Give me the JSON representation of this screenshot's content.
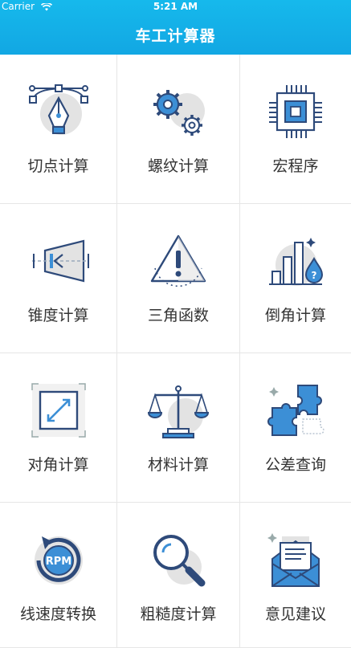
{
  "status_bar": {
    "carrier": "Carrier",
    "time": "5:21 AM"
  },
  "header": {
    "title": "车工计算器"
  },
  "colors": {
    "header": "#12a7e3",
    "icon_stroke": "#2e4a7a",
    "icon_accent": "#3c8fd6",
    "icon_shadow": "#e3e3e3"
  },
  "grid": {
    "items": [
      {
        "label": "切点计算",
        "icon": "pen-tool-icon"
      },
      {
        "label": "螺纹计算",
        "icon": "gears-icon"
      },
      {
        "label": "宏程序",
        "icon": "chip-icon"
      },
      {
        "label": "锥度计算",
        "icon": "taper-icon"
      },
      {
        "label": "三角函数",
        "icon": "warning-triangle-icon"
      },
      {
        "label": "倒角计算",
        "icon": "bar-chart-icon"
      },
      {
        "label": "对角计算",
        "icon": "diagonal-arrow-icon"
      },
      {
        "label": "材料计算",
        "icon": "scale-icon"
      },
      {
        "label": "公差查询",
        "icon": "puzzle-icon"
      },
      {
        "label": "线速度转换",
        "icon": "rpm-icon"
      },
      {
        "label": "粗糙度计算",
        "icon": "magnifier-icon"
      },
      {
        "label": "意见建议",
        "icon": "mail-icon"
      }
    ]
  }
}
